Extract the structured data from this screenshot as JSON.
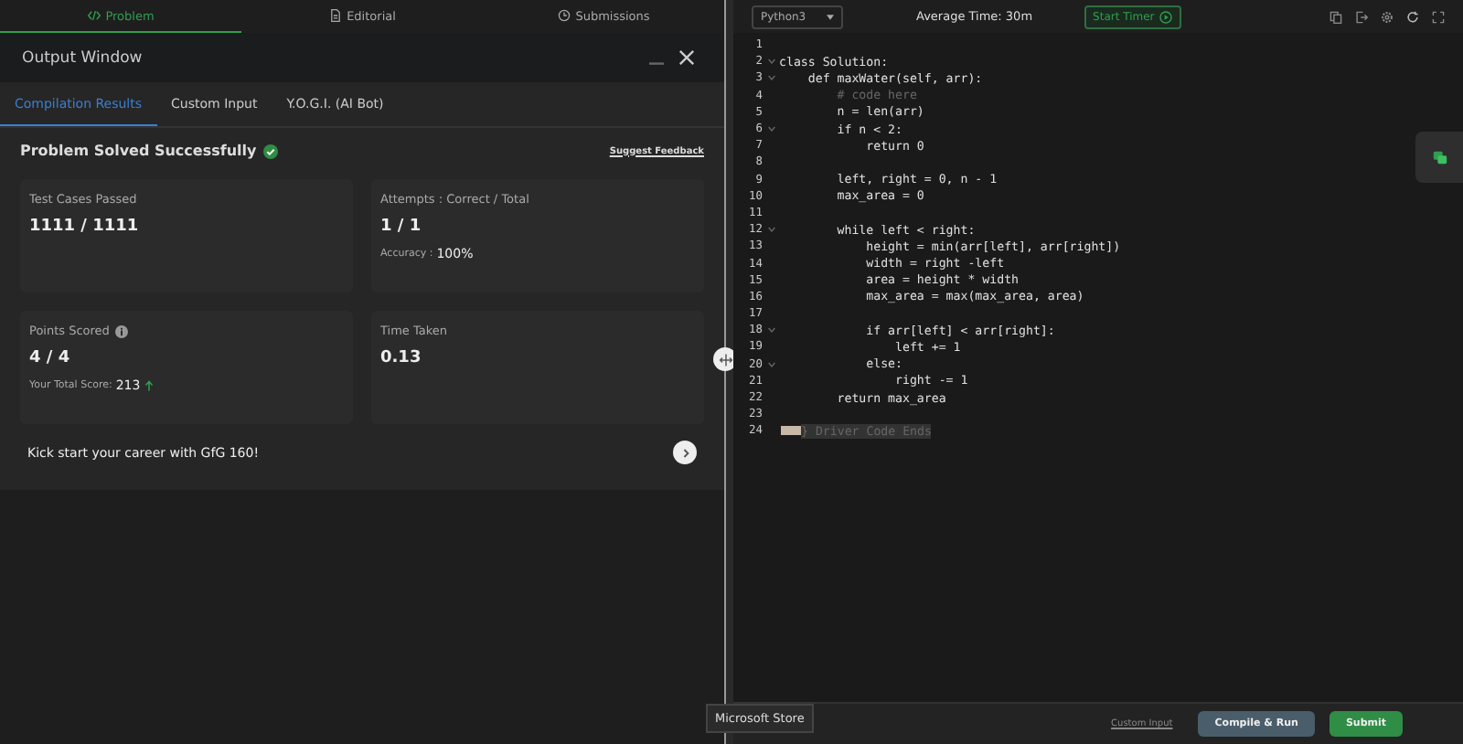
{
  "top_tabs": [
    {
      "label": "Problem",
      "selected": true
    },
    {
      "label": "Editorial",
      "selected": false
    },
    {
      "label": "Submissions",
      "selected": false
    }
  ],
  "output_window": {
    "title": "Output Window",
    "tabs": [
      {
        "label": "Compilation Results",
        "selected": true
      },
      {
        "label": "Custom Input",
        "selected": false
      },
      {
        "label": "Y.O.G.I. (AI Bot)",
        "selected": false
      }
    ],
    "status": "Problem Solved Successfully",
    "feedback_link": "Suggest Feedback",
    "cards": [
      {
        "label": "Test Cases Passed",
        "value": "1111 / 1111",
        "info": false
      },
      {
        "label": "Attempts : Correct / Total",
        "value": "1 / 1",
        "info": false,
        "note_label": "Accuracy :",
        "note_value": "100%",
        "trend_up": false
      },
      {
        "label": "Points Scored",
        "value": "4 / 4",
        "info": true,
        "note_label": "Your Total Score:",
        "note_value": "213",
        "trend_up": true
      },
      {
        "label": "Time Taken",
        "value": "0.13",
        "info": false
      }
    ],
    "promo": "Kick start your career with GfG 160!"
  },
  "editor": {
    "language": "Python3",
    "average_time": "Average Time: 30m",
    "timer_button": "Start Timer",
    "lines": [
      {
        "n": "1",
        "fold": false
      },
      {
        "n": "2",
        "text": "class Solution:",
        "fold": true
      },
      {
        "n": "3",
        "text": "    def maxWater(self, arr):",
        "fold": true
      },
      {
        "n": "4",
        "text": "        # code here",
        "fold": false,
        "kind": "comment"
      },
      {
        "n": "5",
        "text": "        n = len(arr)",
        "fold": false
      },
      {
        "n": "6",
        "text": "        if n < 2:",
        "fold": true
      },
      {
        "n": "7",
        "text": "            return 0",
        "fold": false
      },
      {
        "n": "8",
        "fold": false
      },
      {
        "n": "9",
        "text": "        left, right = 0, n - 1",
        "fold": false
      },
      {
        "n": "10",
        "text": "        max_area = 0",
        "fold": false
      },
      {
        "n": "11",
        "fold": false
      },
      {
        "n": "12",
        "text": "        while left < right:",
        "fold": true
      },
      {
        "n": "13",
        "text": "            height = min(arr[left], arr[right])",
        "fold": false
      },
      {
        "n": "14",
        "text": "            width = right -left",
        "fold": false
      },
      {
        "n": "15",
        "text": "            area = height * width",
        "fold": false
      },
      {
        "n": "16",
        "text": "            max_area = max(max_area, area)",
        "fold": false
      },
      {
        "n": "17",
        "fold": false
      },
      {
        "n": "18",
        "text": "            if arr[left] < arr[right]:",
        "fold": true
      },
      {
        "n": "19",
        "text": "                left += 1",
        "fold": false
      },
      {
        "n": "20",
        "text": "            else:",
        "fold": true
      },
      {
        "n": "21",
        "text": "                right -= 1",
        "fold": false
      },
      {
        "n": "22",
        "text": "        return max_area",
        "fold": false
      },
      {
        "n": "23",
        "fold": false
      },
      {
        "n": "24",
        "text": "} Driver Code Ends",
        "fold": false,
        "kind": "folded"
      }
    ]
  },
  "footer": {
    "link": "Custom Input",
    "run_button": "Compile & Run",
    "submit_button": "Submit"
  },
  "tooltip": "Microsoft Store"
}
